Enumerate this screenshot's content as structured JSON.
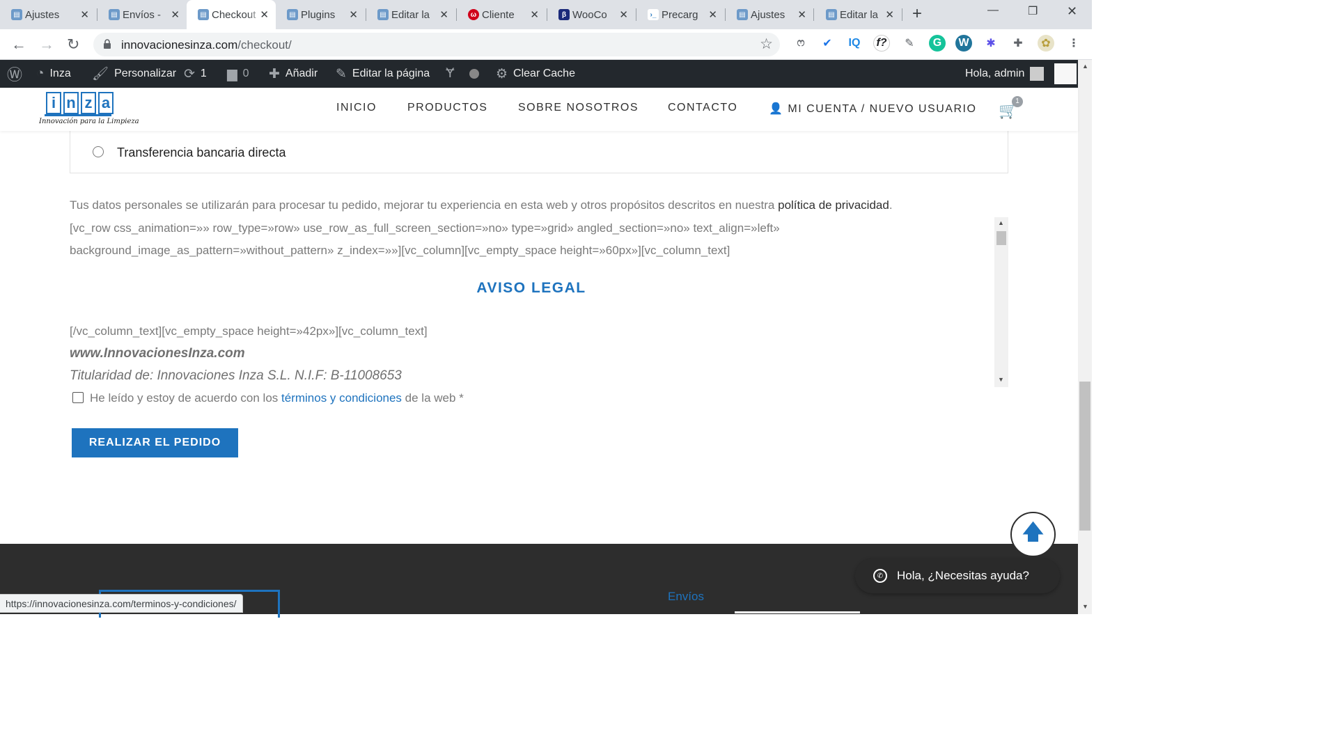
{
  "browser": {
    "tabs": [
      {
        "title": "Ajustes",
        "favicon": "wp-admin-icon",
        "active": false
      },
      {
        "title": "Envíos -",
        "favicon": "wp-admin-icon",
        "active": false
      },
      {
        "title": "Checkout",
        "favicon": "wp-admin-icon",
        "active": true
      },
      {
        "title": "Plugins",
        "favicon": "wp-admin-icon",
        "active": false
      },
      {
        "title": "Editar la",
        "favicon": "wp-admin-icon",
        "active": false
      },
      {
        "title": "Cliente",
        "favicon": "webpanel-icon",
        "active": false
      },
      {
        "title": "WooCo",
        "favicon": "woo-b-icon",
        "active": false
      },
      {
        "title": "Precarg",
        "favicon": "terminal-icon",
        "active": false
      },
      {
        "title": "Ajustes",
        "favicon": "wp-admin-icon",
        "active": false
      },
      {
        "title": "Editar la",
        "favicon": "wp-admin-icon",
        "active": false
      }
    ],
    "url_domain": "innovacionesinza.com",
    "url_path": "/checkout/",
    "status_url": "https://innovacionesinza.com/terminos-y-condiciones/",
    "extensions": [
      "seo-icon",
      "check-icon",
      "iq-icon",
      "fontface-icon",
      "eyedropper-icon",
      "grammarly-icon",
      "wordpress-icon",
      "snowflake-icon",
      "puzzle-icon",
      "profile-avatar"
    ]
  },
  "adminbar": {
    "site_name": "Inza",
    "customize": "Personalizar",
    "updates_count": "1",
    "comments_count": "0",
    "add_new": "Añadir",
    "edit_page": "Editar la página",
    "clear_cache": "Clear Cache",
    "greeting": "Hola, admin"
  },
  "site": {
    "logo_letters": [
      "i",
      "n",
      "z",
      "a"
    ],
    "logo_tagline": "Innovación para la Limpieza",
    "nav": [
      "INICIO",
      "PRODUCTOS",
      "SOBRE NOSOTROS",
      "CONTACTO",
      "MI CUENTA / NUEVO USUARIO"
    ],
    "cart_count": "1"
  },
  "checkout": {
    "payment_option": "Transferencia bancaria directa",
    "privacy_text": "Tus datos personales se utilizarán para procesar tu pedido, mejorar tu experiencia en esta web y otros propósitos descritos en nuestra",
    "privacy_link": "política de privacidad",
    "privacy_end": ".",
    "terms_shortcode_1": "[vc_row css_animation=»» row_type=»row» use_row_as_full_screen_section=»no» type=»grid» angled_section=»no» text_align=»left»",
    "terms_shortcode_2": "background_image_as_pattern=»without_pattern» z_index=»»][vc_column][vc_empty_space height=»60px»][vc_column_text]",
    "terms_heading": "AVISO LEGAL",
    "terms_shortcode_3": "[/vc_column_text][vc_empty_space height=»42px»][vc_column_text]",
    "terms_site": "www.InnovacionesInza.com",
    "terms_owner": "Titularidad de: Innovaciones Inza S.L. N.I.F: B-11008653",
    "accept_prefix": "He leído y estoy de acuerdo con los",
    "accept_link": "términos y condiciones",
    "accept_suffix": "de la web",
    "required_mark": "*",
    "place_order": "REALIZAR EL PEDIDO"
  },
  "footer": {
    "link_envios": "Envíos"
  },
  "chat": {
    "label": "Hola, ¿Necesitas ayuda?"
  },
  "colors": {
    "accent": "#1e73be",
    "adminbar": "#23282d",
    "footer": "#2d2d2d"
  }
}
